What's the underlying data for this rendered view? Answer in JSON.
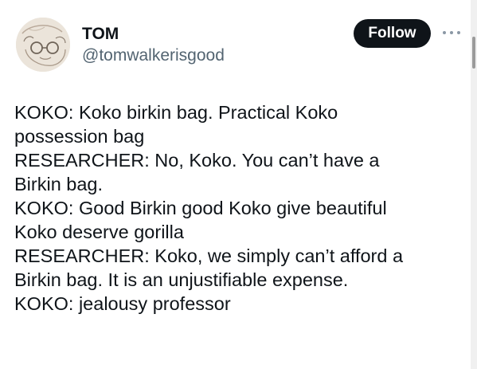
{
  "author": {
    "display_name": "TOM",
    "handle": "@tomwalkerisgood",
    "avatar_icon": "sketch-portrait-avatar"
  },
  "actions": {
    "follow_label": "Follow",
    "more_icon": "more-options-icon"
  },
  "tweet": {
    "lines": [
      "KOKO: Koko birkin bag. Practical Koko",
      "possession bag",
      "RESEARCHER: No, Koko. You can’t have a",
      "Birkin bag.",
      "KOKO: Good Birkin good Koko give beautiful",
      "Koko deserve gorilla",
      "RESEARCHER: Koko, we simply can’t afford a",
      "Birkin bag. It is an unjustifiable expense.",
      "KOKO: jealousy professor"
    ]
  },
  "colors": {
    "text": "#0f1419",
    "secondary_text": "#536471",
    "follow_bg": "#0f1419",
    "follow_text": "#ffffff"
  }
}
